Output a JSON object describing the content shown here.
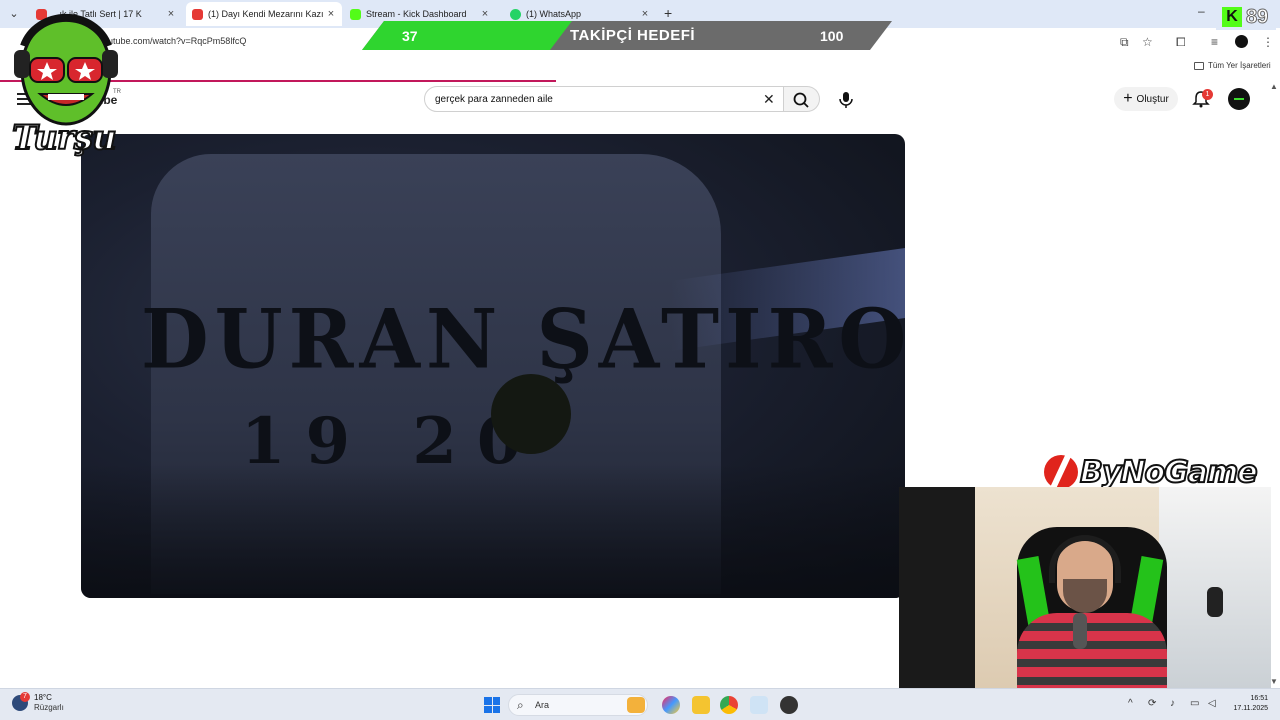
{
  "browser": {
    "tabs": [
      {
        "title": "...ık ile Tatlı Sert | 17 K",
        "favicon_color": "#e53935",
        "active": false
      },
      {
        "title": "(1) Dayı Kendi Mezarını Kazı",
        "favicon_color": "#e53935",
        "active": true
      },
      {
        "title": "Stream - Kick Dashboard",
        "favicon_color": "#53fc18",
        "active": false
      },
      {
        "title": "(1) WhatsApp",
        "favicon_color": "#25d366",
        "active": false
      }
    ],
    "close_glyph": "×",
    "new_tab_glyph": "+",
    "minimize_glyph": "–",
    "url": "utube.com/watch?v=RqcPm58lfcQ",
    "bookmarks_all": "Tüm Yer İşaretleri"
  },
  "youtube": {
    "logo_fragment": "ube",
    "logo_region": "TR",
    "search_query": "gerçek para zanneden aile",
    "create_label": "Oluştur",
    "notification_count": "1"
  },
  "video": {
    "visible_engraving_line1": "DURAN ŞATIROĞLU",
    "visible_engraving_line2": "19  20"
  },
  "overlays": {
    "follower_goal": {
      "current": "37",
      "title": "TAKİPÇİ HEDEFİ",
      "target": "100",
      "progress_fraction": 0.37
    },
    "mascot_name": "Turşu",
    "kick_viewer_count": "89",
    "sponsor": "ByNoGame"
  },
  "taskbar": {
    "weather_temp": "18°C",
    "weather_desc": "Rüzgarlı",
    "weather_badge": "7",
    "search_placeholder": "Ara",
    "time": "16:51",
    "date": "17.11.2025"
  },
  "colors": {
    "accent_red": "#c2185b",
    "kick_green": "#53fc18",
    "goal_green": "#2fd52f",
    "goal_gray": "#6b6b6b"
  }
}
